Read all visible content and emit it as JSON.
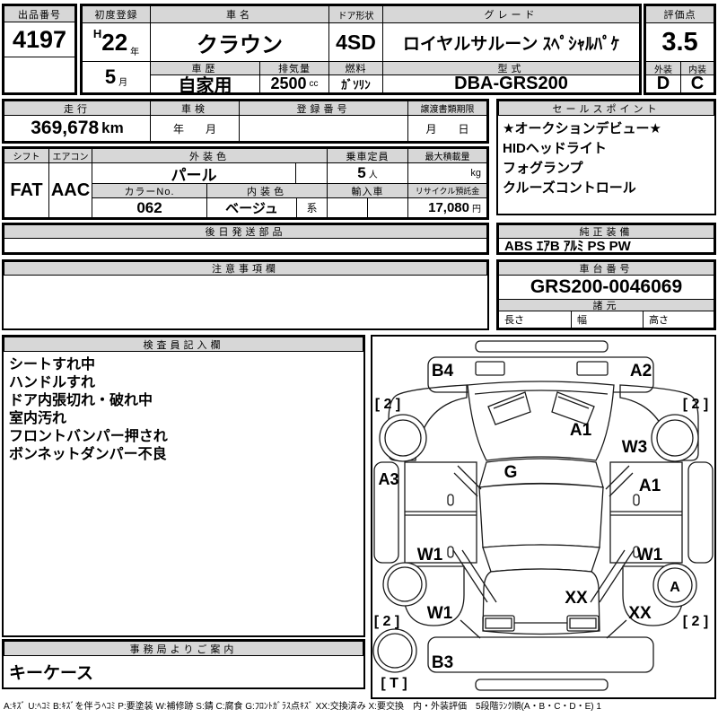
{
  "auction": {
    "no_label": "出品番号",
    "no": "4197"
  },
  "registration": {
    "label": "初度登録",
    "era": "H",
    "year": "22",
    "year_unit": "年",
    "month": "5",
    "month_unit": "月"
  },
  "car": {
    "name_label": "車名",
    "name": "クラウン",
    "door_label": "ドア形状",
    "door": "4SD",
    "grade_label": "グレード",
    "grade": "ロイヤルサルーン ｽﾍﾟｼｬﾙﾊﾟｹ",
    "history_label": "車歴",
    "history": "自家用",
    "displacement_label": "排気量",
    "displacement": "2500",
    "displacement_unit": "cc",
    "fuel_label": "燃料",
    "fuel": "ｶﾞｿﾘﾝ",
    "model_label": "型式",
    "model": "DBA-GRS200"
  },
  "score": {
    "label": "評価点",
    "value": "3.5",
    "ext_label": "外装",
    "ext": "D",
    "int_label": "内装",
    "int": "C"
  },
  "usage": {
    "mileage_label": "走行",
    "mileage": "369,678",
    "mileage_unit": "km",
    "inspection_label": "車検",
    "inspection_placeholder": "年　　月",
    "regno_label": "登録番号",
    "transfer_label": "譲渡書類期限",
    "transfer_placeholder": "月　　日"
  },
  "sales": {
    "label": "セールスポイント",
    "points": [
      "★オークションデビュー★",
      "HIDヘッドライト",
      "フォグランプ",
      "クルーズコントロール"
    ]
  },
  "spec": {
    "shift_label": "シフト",
    "shift": "FAT",
    "ac_label": "エアコン",
    "ac": "AAC",
    "ext_color_label": "外装色",
    "ext_color": "パール",
    "color_no_label": "カラーNo.",
    "color_no": "062",
    "int_color_label": "内装色",
    "int_color": "ベージュ",
    "int_color_suffix": "系",
    "capacity_label": "乗車定員",
    "capacity": "5",
    "capacity_unit": "人",
    "payload_label": "最大積載量",
    "payload_unit": "kg",
    "import_label": "輸入車",
    "recycle_label": "リサイクル預託金",
    "recycle": "17,080",
    "recycle_unit": "円"
  },
  "parts": {
    "label": "後日発送部品"
  },
  "equipment": {
    "label": "純正装備",
    "value": "ABS ｴｱB ｱﾙﾐ PS PW"
  },
  "caution": {
    "label": "注意事項欄"
  },
  "chassis": {
    "label": "車台番号",
    "value": "GRS200-0046069",
    "dims_label": "諸元",
    "length_label": "長さ",
    "width_label": "幅",
    "height_label": "高さ"
  },
  "inspection": {
    "label": "検査員記入欄",
    "notes": [
      "シートすれ中",
      "ハンドルすれ",
      "ドア内張切れ・破れ中",
      "室内汚れ",
      "フロントバンパー押され",
      "ボンネットダンパー不良"
    ]
  },
  "office": {
    "label": "事務局よりご案内",
    "value": "キーケース"
  },
  "diagram": {
    "front_bumper_left": "B4",
    "front_bumper_right": "A2",
    "hood": "A1",
    "front_right_fender": "W3",
    "windshield": "G",
    "left_rocker": "A3",
    "right_front_door": "A1",
    "left_rear_door": "W1",
    "right_rear_door": "W1",
    "left_quarter": "W1",
    "trunk": "XX",
    "right_quarter": "XX",
    "rear_bumper": "B3",
    "rear_right_wheel": "A",
    "front_left_corner": "[ 2 ]",
    "front_right_corner": "[ 2 ]",
    "rear_left_corner": "[ 2 ]",
    "rear_right_corner": "[ 2 ]",
    "spare_tire": "[ T ]"
  },
  "legend": "A:ｷｽﾞ U:ﾍｺﾐ B:ｷｽﾞを伴うﾍｺﾐ P:要塗装 W:補修跡 S:錆 C:腐食 G:ﾌﾛﾝﾄｶﾞﾗｽ点ｷｽﾞ XX:交換済み X:要交換　内・外装評価　5段階ﾗﾝｸ順(A・B・C・D・E) 1"
}
